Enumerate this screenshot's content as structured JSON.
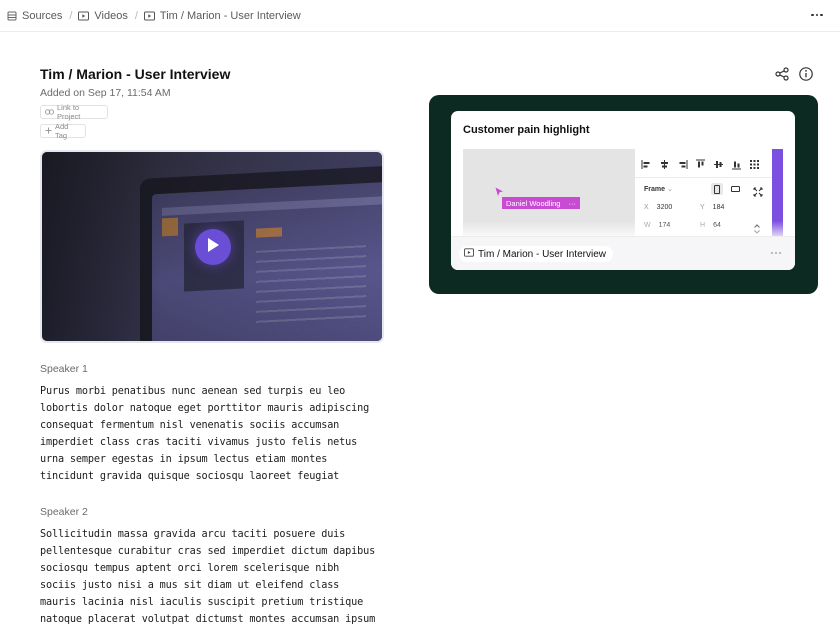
{
  "breadcrumb": {
    "items": [
      {
        "label": "Sources",
        "icon": "stack-icon"
      },
      {
        "label": "Videos",
        "icon": "video-icon"
      },
      {
        "label": "Tim / Marion - User Interview",
        "icon": "video-icon"
      }
    ],
    "separator": "/"
  },
  "header": {
    "title": "Tim / Marion - User Interview",
    "added": "Added on Sep 17, 11:54 AM",
    "link_label": "Link to Project",
    "tag_label": "Add Tag"
  },
  "video": {
    "play_icon": "play-icon",
    "accent": "#6a4fd6"
  },
  "transcript": [
    {
      "speaker": "Speaker 1",
      "lines": [
        "Purus morbi penatibus nunc aenean sed turpis eu leo",
        "lobortis dolor natoque eget porttitor mauris adipiscing",
        "consequat fermentum nisl venenatis sociis accumsan",
        "imperdiet class cras taciti vivamus justo felis netus",
        "urna semper egestas in ipsum lectus etiam montes",
        "tincidunt gravida quisque sociosqu laoreet feugiat"
      ]
    },
    {
      "speaker": "Speaker 2",
      "lines": [
        "Sollicitudin massa gravida arcu taciti posuere duis",
        "pellentesque curabitur cras sed imperdiet dictum dapibus",
        "sociosqu tempus aptent orci lorem scelerisque nibh",
        "sociis justo nisi a mus sit diam ut eleifend class",
        "mauris lacinia nisl iaculis suscipit pretium tristique",
        "natoque placerat volutpat dictumst montes accumsan ipsum"
      ]
    }
  ],
  "highlight": {
    "title": "Customer pain highlight",
    "cursor_user": "Daniel Woodling",
    "panel": {
      "frame_label": "Frame",
      "x_label": "X",
      "x_value": "3200",
      "y_label": "Y",
      "y_value": "184",
      "w_label": "W",
      "w_value": "174",
      "h_label": "H",
      "h_value": "64"
    },
    "source_label": "Tim / Marion - User Interview",
    "card_bg": "#0d2a22",
    "tag_color": "#c94bd4",
    "strip_color": "#7b4fe0"
  }
}
